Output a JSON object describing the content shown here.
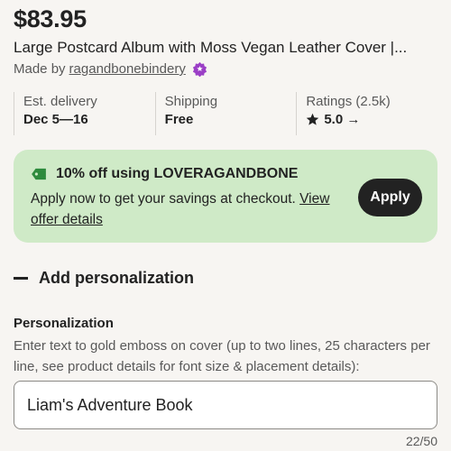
{
  "listing": {
    "price": "$83.95",
    "title": "Large Postcard Album with Moss Vegan Leather Cover |...",
    "made_by_prefix": "Made by",
    "shop_name": "ragandbonebindery"
  },
  "stats": [
    {
      "label": "Est. delivery",
      "value": "Dec 5—16"
    },
    {
      "label": "Shipping",
      "value": "Free"
    },
    {
      "label": "Ratings (2.5k)",
      "value": "5.0 →"
    }
  ],
  "offer": {
    "title": "10% off using LOVERAGANDBONE",
    "body": "Apply now to get your savings at checkout.",
    "link": "View offer details",
    "button": "Apply",
    "accent": "#cfeac7",
    "tag_color": "#2e8b3d"
  },
  "personalization": {
    "toggle_label": "Add personalization",
    "label": "Personalization",
    "help": "Enter text to gold emboss on cover (up to two lines, 25 characters per line, see product details for font size & placement details):",
    "value": "Liam's Adventure Book",
    "counter": "22/50"
  },
  "colors": {
    "star_seller_badge": "#9b3fc6",
    "text": "#222222",
    "muted": "#595959"
  }
}
